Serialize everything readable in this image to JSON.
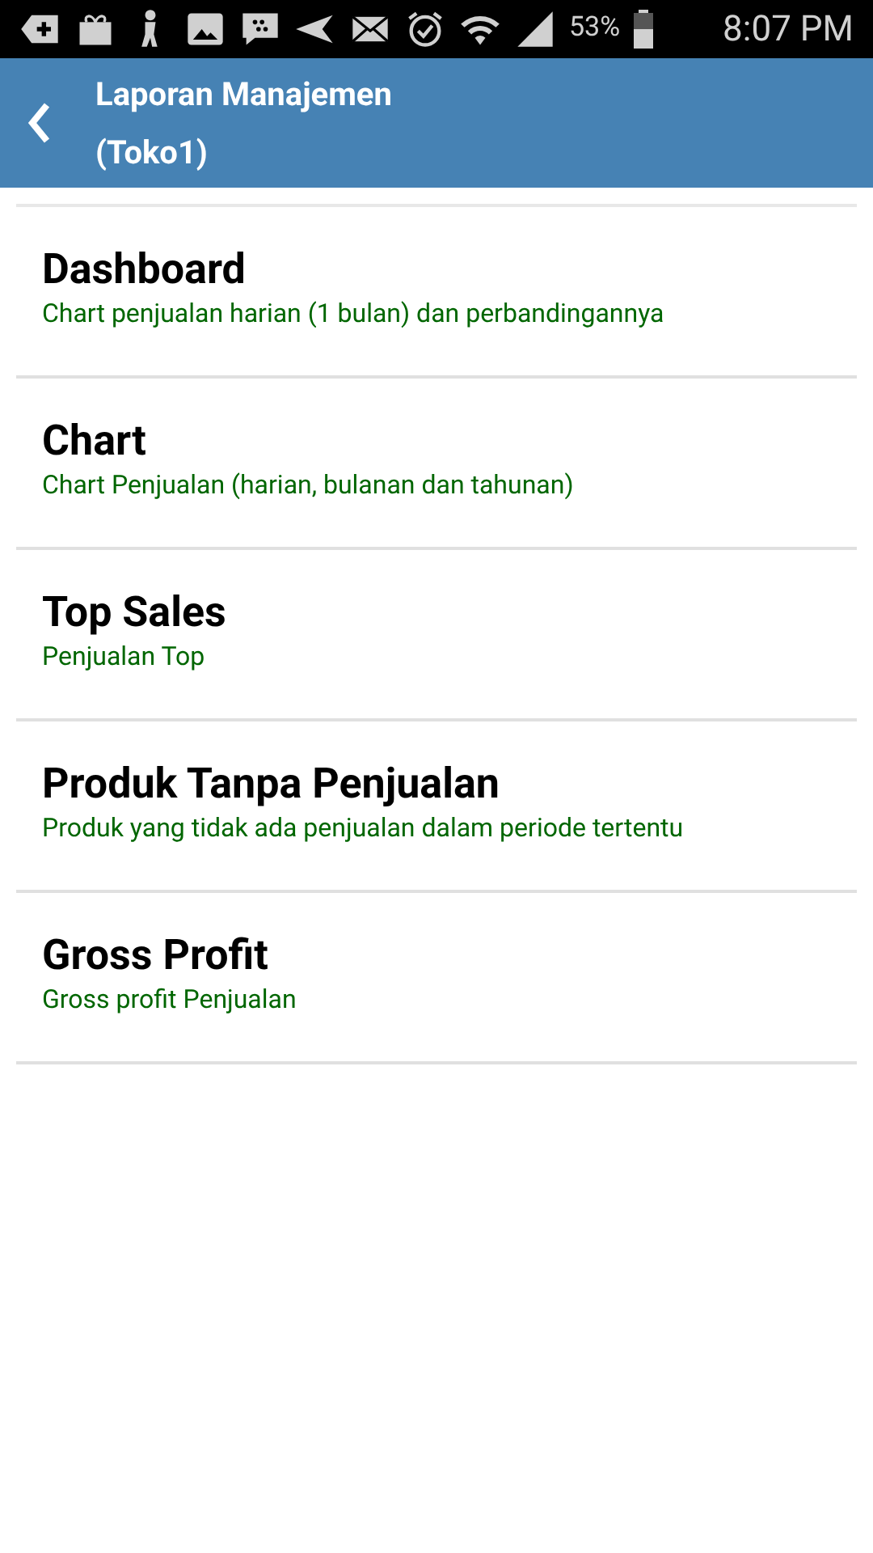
{
  "status_bar": {
    "battery": "53%",
    "time": "8:07 PM"
  },
  "app_bar": {
    "title": "Laporan Manajemen",
    "subtitle": "(Toko1)"
  },
  "menu_items": [
    {
      "title": "Dashboard",
      "description": "Chart penjualan harian (1 bulan) dan perbandingannya"
    },
    {
      "title": "Chart",
      "description": "Chart Penjualan (harian, bulanan dan tahunan)"
    },
    {
      "title": "Top Sales",
      "description": "Penjualan Top"
    },
    {
      "title": "Produk Tanpa Penjualan",
      "description": "Produk yang tidak ada penjualan dalam periode tertentu"
    },
    {
      "title": "Gross Profit",
      "description": "Gross profit Penjualan"
    }
  ]
}
